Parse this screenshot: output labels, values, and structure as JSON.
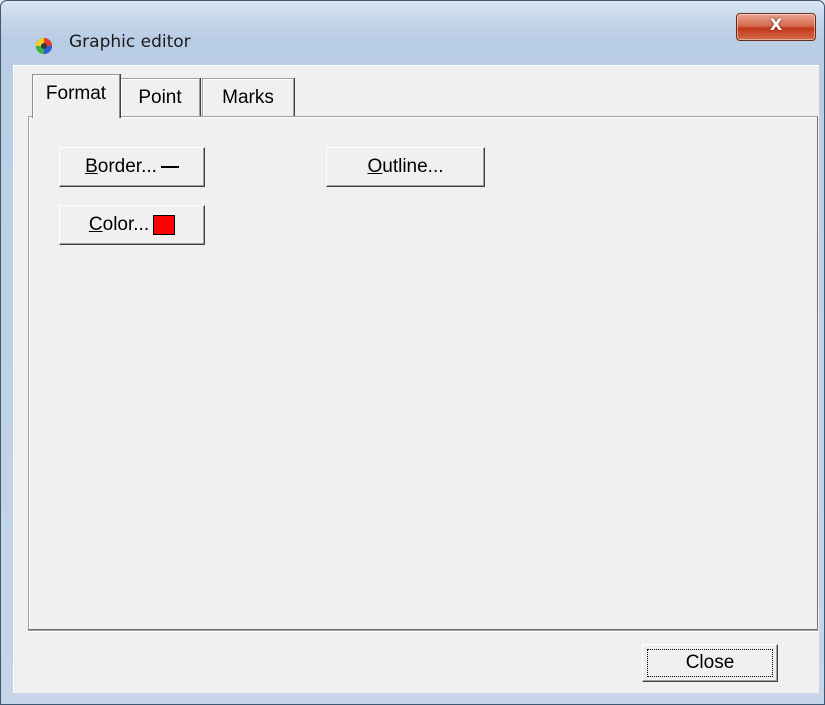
{
  "window": {
    "title": "Graphic editor",
    "icon": "palette-globe-icon",
    "close_glyph": "X"
  },
  "tabs": [
    {
      "label": "Format",
      "active": true
    },
    {
      "label": "Point",
      "active": false
    },
    {
      "label": "Marks",
      "active": false
    }
  ],
  "format_panel": {
    "border_button": {
      "mnemonic": "B",
      "rest": "order...",
      "icon": "line-style-icon"
    },
    "outline_button": {
      "mnemonic": "O",
      "rest": "utline..."
    },
    "color_button": {
      "mnemonic": "C",
      "rest": "olor...",
      "swatch_color": "#ff0000"
    }
  },
  "footer": {
    "close_label": "Close"
  }
}
